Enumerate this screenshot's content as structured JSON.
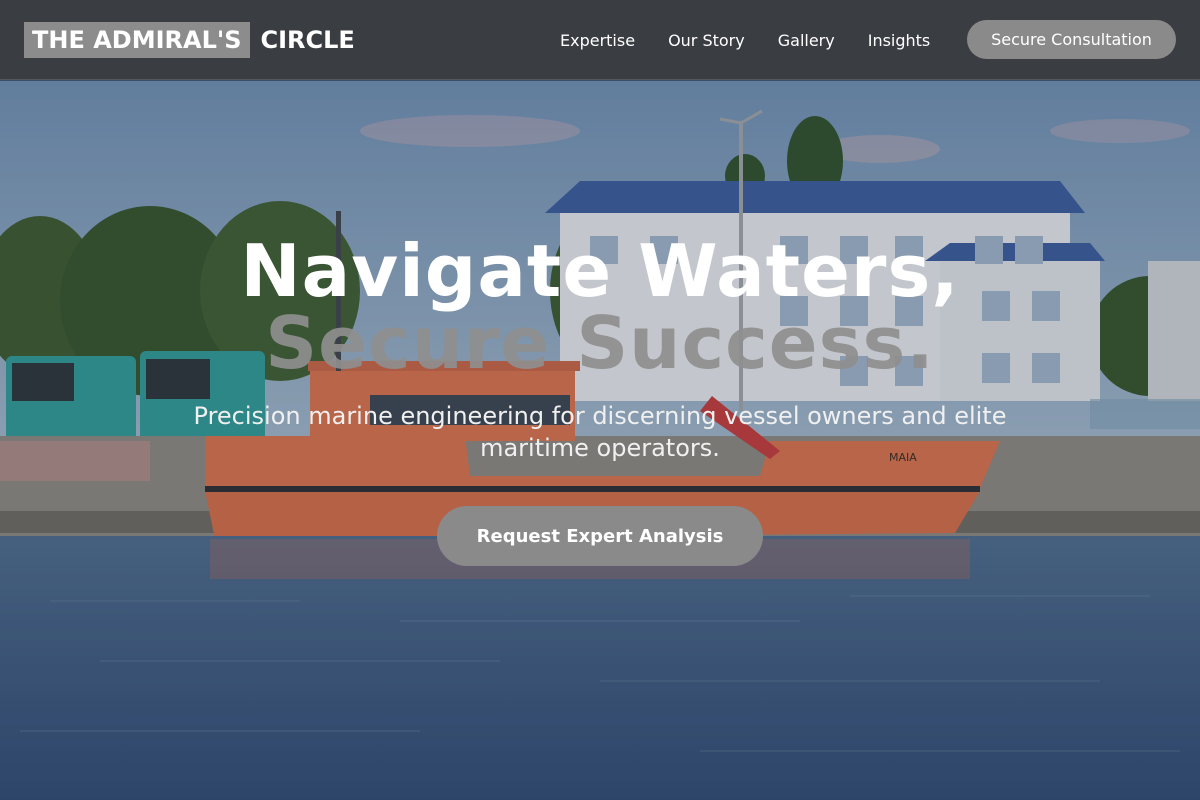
{
  "brand": {
    "boxed": "THE ADMIRAL'S",
    "plain": "CIRCLE"
  },
  "nav": {
    "links": [
      "Expertise",
      "Our Story",
      "Gallery",
      "Insights"
    ],
    "cta": "Secure Consultation"
  },
  "hero": {
    "title_line1": "Navigate Waters,",
    "title_line2": "Secure Success.",
    "subtitle": "Precision marine engineering for discerning vessel owners and elite maritime operators.",
    "cta": "Request Expert Analysis",
    "image": {
      "description_icon": "harbor-photo",
      "boat_name": "MAIA"
    }
  },
  "colors": {
    "navbar_bg": "#3a3d42",
    "button_grey": "#8a8a8a",
    "boat_orange": "#d9704a",
    "water_blue": "#3f5a82"
  }
}
